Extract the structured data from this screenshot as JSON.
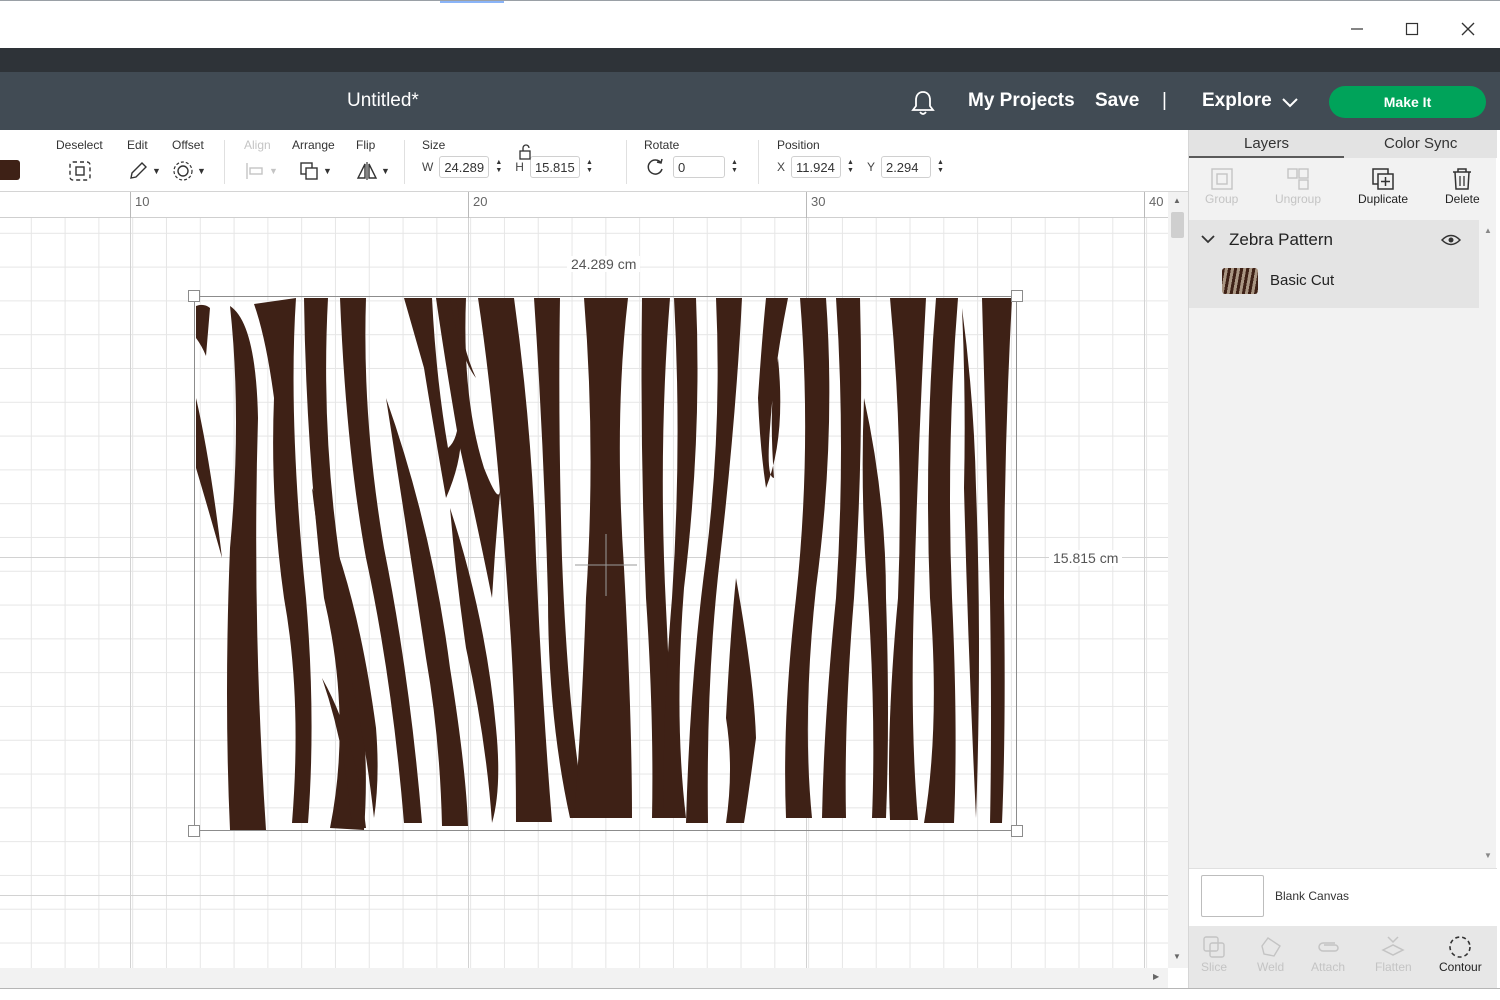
{
  "app": {
    "document_title": "Untitled*",
    "nav": {
      "my_projects": "My Projects",
      "save": "Save",
      "separator": "|",
      "explore": "Explore"
    },
    "make_it": "Make It"
  },
  "toolbar": {
    "deselect": "Deselect",
    "edit": "Edit",
    "offset": "Offset",
    "align": "Align",
    "arrange": "Arrange",
    "flip": "Flip",
    "size": {
      "label": "Size",
      "w_label": "W",
      "w": "24.289",
      "h_label": "H",
      "h": "15.815"
    },
    "rotate": {
      "label": "Rotate",
      "value": "0"
    },
    "position": {
      "label": "Position",
      "x_label": "X",
      "x": "11.924",
      "y_label": "Y",
      "y": "2.294"
    },
    "color": "#3e2116"
  },
  "canvas": {
    "ruler_labels": [
      "10",
      "20",
      "30",
      "40"
    ],
    "width_label": "24.289 cm",
    "height_label": "15.815 cm",
    "pattern_color": "#3e2116"
  },
  "panel": {
    "tabs": {
      "layers": "Layers",
      "color_sync": "Color Sync"
    },
    "tools": {
      "group": "Group",
      "ungroup": "Ungroup",
      "duplicate": "Duplicate",
      "delete": "Delete"
    },
    "layer_group": "Zebra Pattern",
    "layer_item": "Basic Cut",
    "blank_canvas": "Blank Canvas",
    "bottom_tools": {
      "slice": "Slice",
      "weld": "Weld",
      "attach": "Attach",
      "flatten": "Flatten",
      "contour": "Contour"
    }
  },
  "colors": {
    "header": "#414b54",
    "make_it": "#00a35a",
    "panel": "#f2f2f2"
  }
}
